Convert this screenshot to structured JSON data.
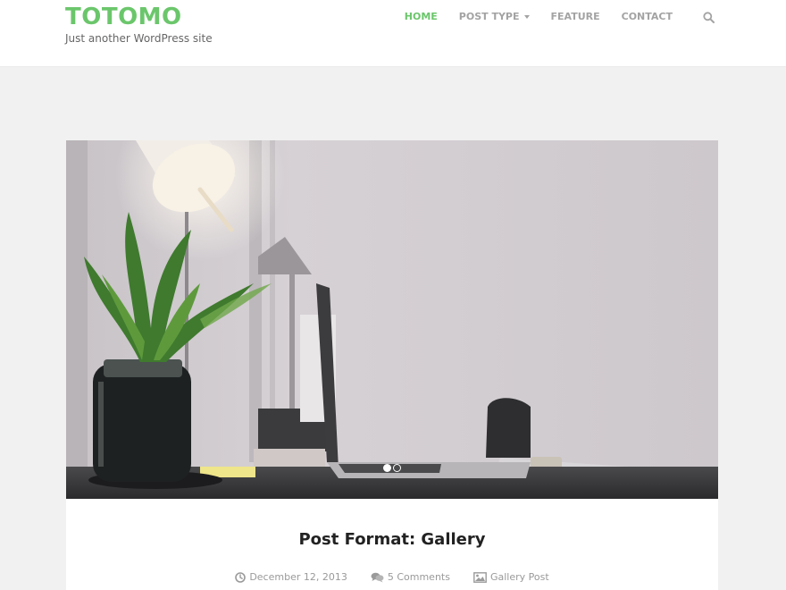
{
  "header": {
    "site_title": "TOTOMO",
    "tagline": "Just another WordPress site"
  },
  "nav": {
    "items": [
      {
        "label": "HOME",
        "active": true
      },
      {
        "label": "POST TYPE",
        "has_dropdown": true
      },
      {
        "label": "FEATURE"
      },
      {
        "label": "CONTACT"
      }
    ],
    "search_icon": "search-icon"
  },
  "post": {
    "image": "gallery photo: desk with potted plant in glass jar, laptop and lamp",
    "slider": {
      "slide_count": 2,
      "active_slide": 1
    },
    "title": "Post Format: Gallery",
    "meta": {
      "date": "December 12, 2013",
      "comments": "5 Comments",
      "format": "Gallery Post"
    }
  },
  "colors": {
    "accent": "#6bc66b",
    "nav_text": "#a3a3a3",
    "page_background": "#f1f1f1",
    "meta_text": "#9a9a9a"
  }
}
